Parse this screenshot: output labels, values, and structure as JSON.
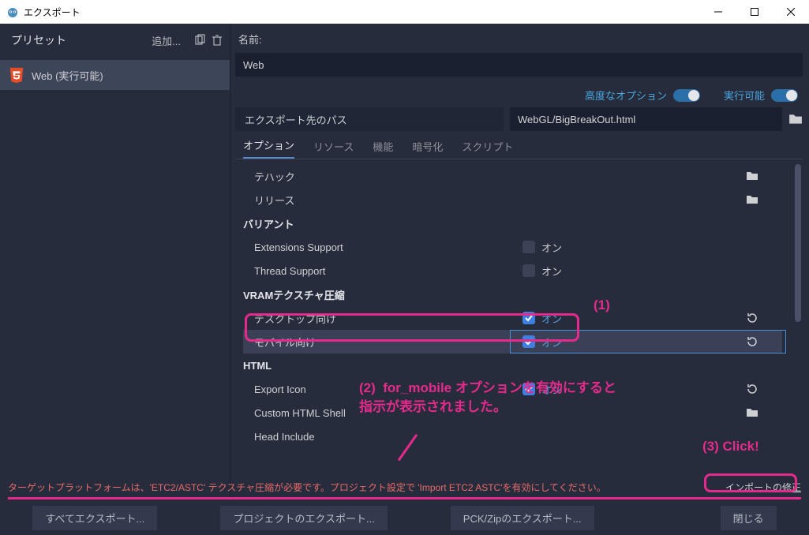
{
  "window": {
    "title": "エクスポート"
  },
  "presets": {
    "header": "プリセット",
    "add": "追加...",
    "items": [
      {
        "label": "Web (実行可能)"
      }
    ]
  },
  "name": {
    "label": "名前:",
    "value": "Web"
  },
  "top_toggles": {
    "advanced": "高度なオプション",
    "runnable": "実行可能"
  },
  "path": {
    "label": "エクスポート先のパス",
    "value": "WebGL/BigBreakOut.html"
  },
  "tabs": {
    "options": "オプション",
    "resources": "リソース",
    "features": "機能",
    "encryption": "暗号化",
    "script": "スクリプト"
  },
  "options": {
    "debug": "テハック",
    "release": "リリース",
    "variant_header": "バリアント",
    "extensions": {
      "label": "Extensions Support",
      "text": "オン"
    },
    "thread": {
      "label": "Thread Support",
      "text": "オン"
    },
    "vram_header": "VRAMテクスチャ圧縮",
    "desktop": {
      "label": "デスクトップ向け",
      "text": "オン"
    },
    "mobile": {
      "label": "モバイル向け",
      "text": "オン"
    },
    "html_header": "HTML",
    "export_icon": {
      "label": "Export Icon",
      "text": "オン"
    },
    "custom_shell": {
      "label": "Custom HTML Shell"
    },
    "head_include": {
      "label": "Head Include"
    }
  },
  "error": {
    "text": "ターゲットプラットフォームは、'ETC2/ASTC' テクスチャ圧縮が必要です。プロジェクト設定で 'Import ETC2 ASTC'を有効にしてください。",
    "fix": "インポートの修正"
  },
  "buttons": {
    "export_all": "すべてエクスポート...",
    "export_project": "プロジェクトのエクスポート...",
    "export_pck": "PCK/Zipのエクスポート...",
    "close": "閉じる"
  },
  "annotations": {
    "one": "(1)",
    "two": "(2)  for_mobile オプションを有効にすると\n指示が表示されました。",
    "three": "(3) Click!"
  }
}
